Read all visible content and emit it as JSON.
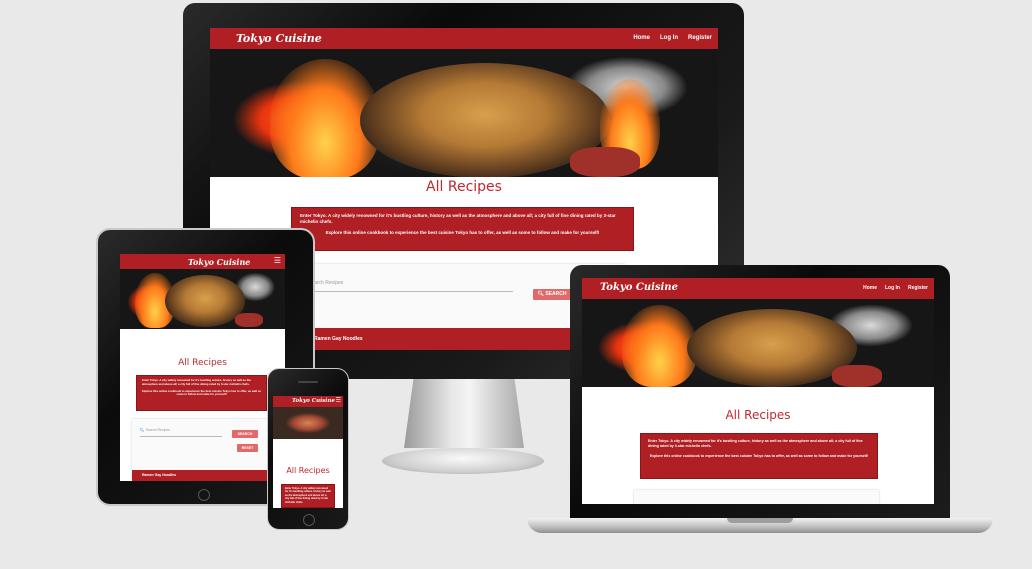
{
  "site": {
    "brand": "Tokyo Cuisine",
    "nav": {
      "home": "Home",
      "login": "Log In",
      "register": "Register"
    },
    "page_title": "All Recipes",
    "intro_line1": "Enter Tokyo. A city widely renowned for it's bustling culture, history as well as the atmosphere and above all; a city full of fine dining rated by 3-star michelin chefs.",
    "intro_line2": "Explore this online cookbook to experience the best cuisine Tokyo has to offer, as well as some to follow and make for yourself!",
    "search_placeholder": "Search Recipes",
    "search_button": "SEARCH",
    "reset_button": "RESET",
    "first_recipe": "Ramen Gay Noodles"
  },
  "colors": {
    "brand_red": "#b01f24",
    "title_red": "#c0282d",
    "button_pink": "#e06a6a"
  },
  "icons": {
    "menu": "hamburger-icon",
    "search": "search-icon",
    "expand": "chevron-icon"
  }
}
